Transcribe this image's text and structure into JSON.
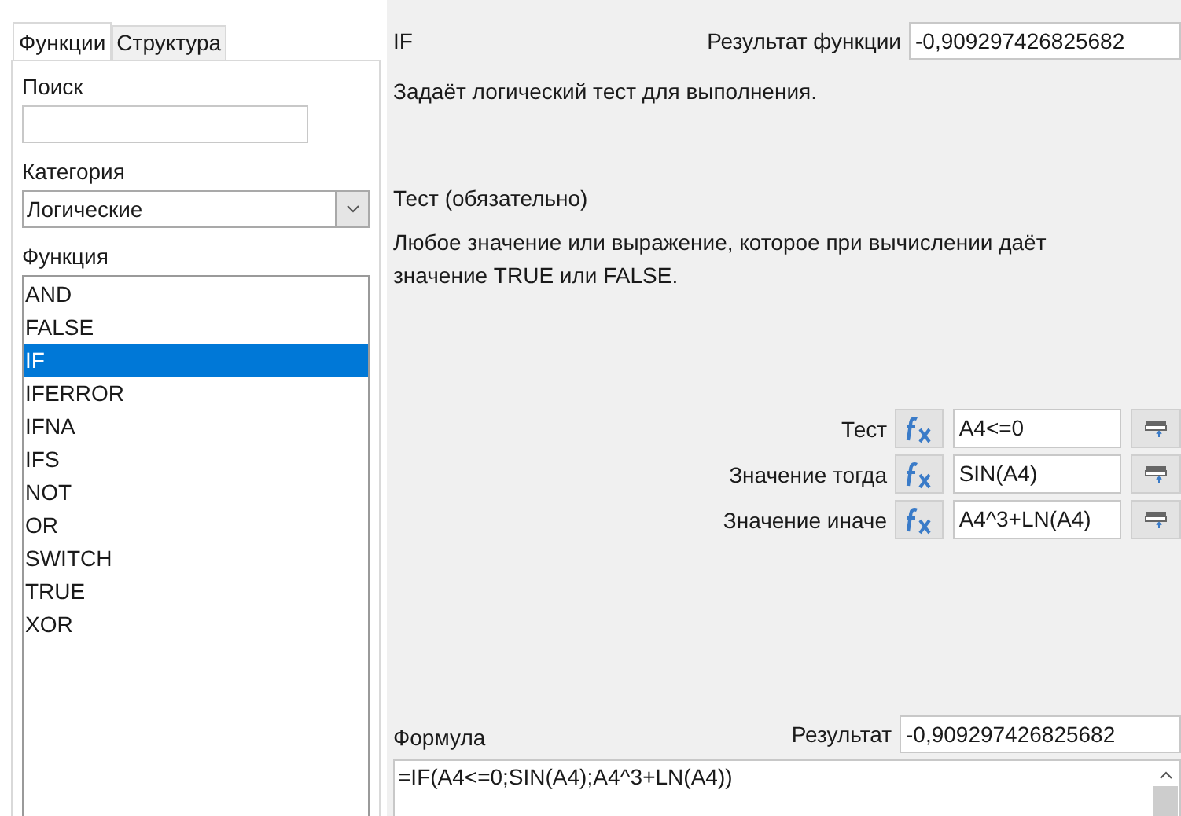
{
  "tabs": [
    {
      "label": "Функции",
      "selected": true
    },
    {
      "label": "Структура",
      "selected": false
    }
  ],
  "search": {
    "label": "Поиск"
  },
  "category": {
    "label": "Категория",
    "value": "Логические"
  },
  "functions": {
    "label": "Функция",
    "items": [
      {
        "name": "AND",
        "selected": false
      },
      {
        "name": "FALSE",
        "selected": false
      },
      {
        "name": "IF",
        "selected": true
      },
      {
        "name": "IFERROR",
        "selected": false
      },
      {
        "name": "IFNA",
        "selected": false
      },
      {
        "name": "IFS",
        "selected": false
      },
      {
        "name": "NOT",
        "selected": false
      },
      {
        "name": "OR",
        "selected": false
      },
      {
        "name": "SWITCH",
        "selected": false
      },
      {
        "name": "TRUE",
        "selected": false
      },
      {
        "name": "XOR",
        "selected": false
      }
    ]
  },
  "function_name": "IF",
  "function_result": {
    "label": "Результат функции",
    "value": "-0,909297426825682"
  },
  "description": "Задаёт логический тест для выполнения.",
  "argument_title": "Тест (обязательно)",
  "argument_description": "Любое значение или выражение, которое при вычислении даёт значение TRUE или FALSE.",
  "arguments": [
    {
      "label": "Тест",
      "value": "A4<=0"
    },
    {
      "label": "Значение тогда",
      "value": "SIN(A4)"
    },
    {
      "label": "Значение иначе",
      "value": "A4^3+LN(A4)"
    }
  ],
  "formula": {
    "label": "Формула",
    "value": "=IF(A4<=0;SIN(A4);A4^3+LN(A4))"
  },
  "result": {
    "label": "Результат",
    "value": "-0,909297426825682"
  }
}
